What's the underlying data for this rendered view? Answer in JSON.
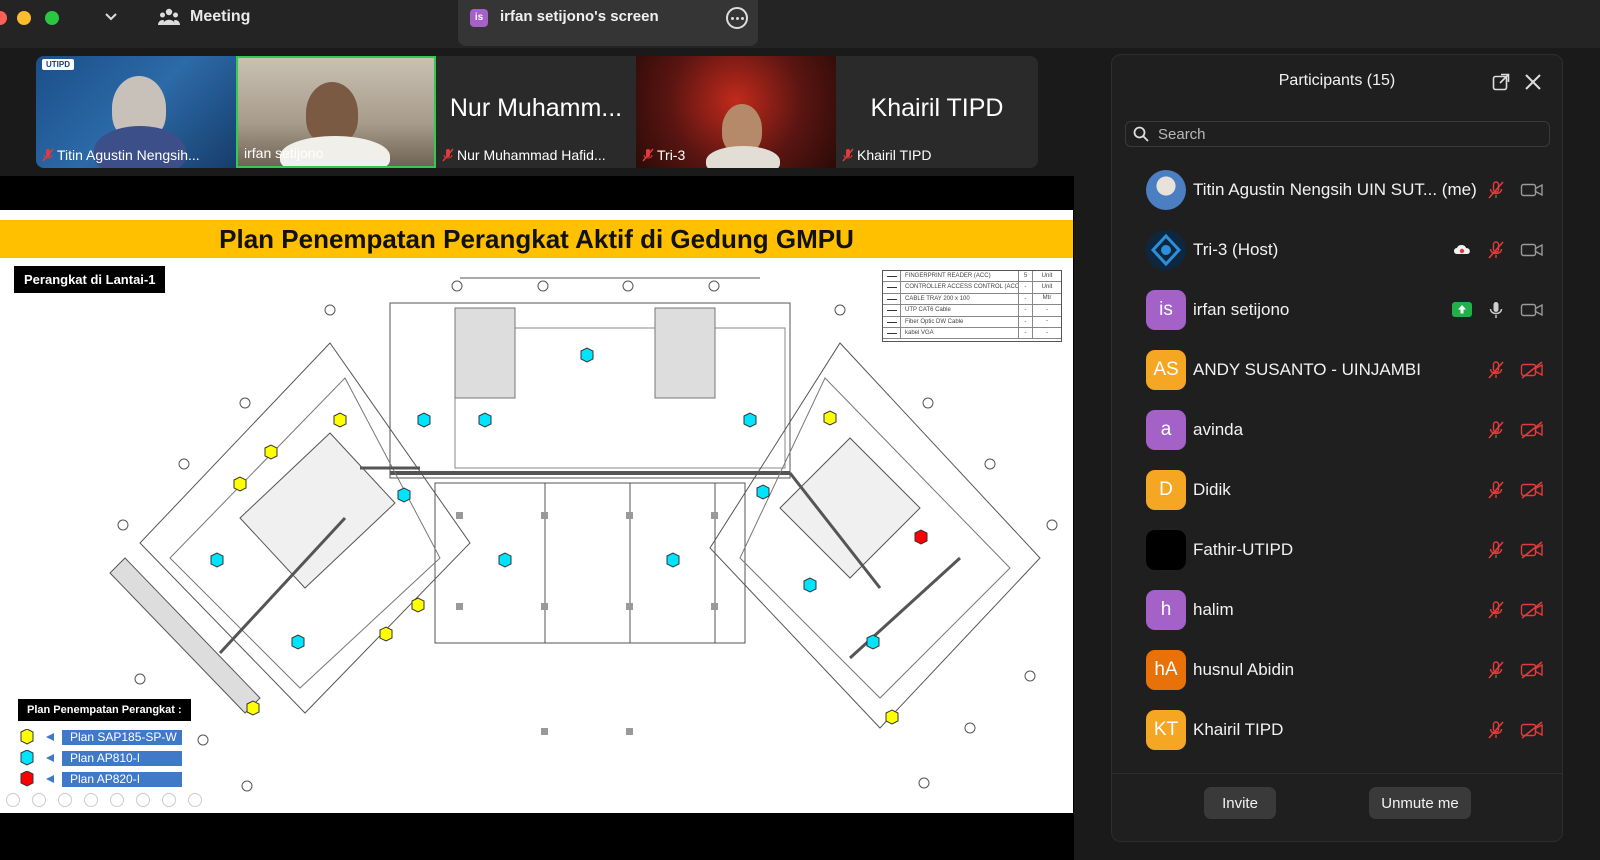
{
  "titlebar": {
    "meeting_label": "Meeting",
    "share_badge": "is",
    "share_label": "irfan setijono's screen"
  },
  "thumbnails": [
    {
      "name": "Titin Agustin Nengsih...",
      "muted": true,
      "video": true,
      "logo": "UTIPD"
    },
    {
      "name": "irfan setijono",
      "muted": false,
      "video": true,
      "active_speaker": true
    },
    {
      "name": "Nur Muhammad Hafid...",
      "big_name": "Nur Muhamm...",
      "muted": true,
      "video": false
    },
    {
      "name": "Tri-3",
      "muted": true,
      "video": true
    },
    {
      "name": "Khairil TIPD",
      "big_name": "Khairil TIPD",
      "muted": true,
      "video": false
    }
  ],
  "slide": {
    "title": "Plan Penempatan Perangkat Aktif di Gedung GMPU",
    "floor_label": "Perangkat di Lantai-1",
    "legend_title": "Plan Penempatan Perangkat :",
    "legend": [
      {
        "label": "Plan SAP185-SP-W",
        "shape": "hexagon",
        "color": "#ffff00"
      },
      {
        "label": "Plan AP810-I",
        "shape": "hexagon",
        "color": "#00e5ff"
      },
      {
        "label": "Plan AP820-I",
        "shape": "hexagon",
        "color": "#ff0000"
      }
    ],
    "cable_table": [
      {
        "desc": "FINGERPRINT READER (ACC)",
        "qty": "5",
        "unit": "Unit"
      },
      {
        "desc": "CONTROLLER ACCESS CONTROL (ACC)",
        "qty": "-",
        "unit": "Unit"
      },
      {
        "desc": "CABLE TRAY 200 x 100",
        "qty": "-",
        "unit": "Mtr"
      },
      {
        "desc": "UTP CAT6 Cable",
        "qty": "-",
        "unit": "-"
      },
      {
        "desc": "Fiber Optic DW Cable",
        "qty": "-",
        "unit": "-"
      },
      {
        "desc": "kabel VGA",
        "qty": "-",
        "unit": "-"
      }
    ]
  },
  "panel": {
    "title": "Participants (15)",
    "search_placeholder": "Search",
    "invite_label": "Invite",
    "unmute_label": "Unmute me",
    "participants": [
      {
        "name": "Titin Agustin Nengsih UIN SUT...  (me)",
        "initials": "",
        "color": "#4b7fc1",
        "mic": "muted",
        "cam": "on",
        "photo": true
      },
      {
        "name": "Tri-3 (Host)",
        "initials": "",
        "color": "#0e2740",
        "mic": "muted",
        "cam": "on",
        "photo": true,
        "extra": "cloud"
      },
      {
        "name": "irfan setijono",
        "initials": "is",
        "color": "#a462c9",
        "mic": "on",
        "cam": "on",
        "extra": "share"
      },
      {
        "name": "ANDY SUSANTO - UINJAMBI",
        "initials": "AS",
        "color": "#f5a623",
        "mic": "muted",
        "cam": "off"
      },
      {
        "name": "avinda",
        "initials": "a",
        "color": "#a462c9",
        "mic": "muted",
        "cam": "off"
      },
      {
        "name": "Didik",
        "initials": "D",
        "color": "#f5a623",
        "mic": "muted",
        "cam": "off"
      },
      {
        "name": "Fathir-UTIPD",
        "initials": "",
        "color": "#000000",
        "mic": "muted",
        "cam": "off"
      },
      {
        "name": "halim",
        "initials": "h",
        "color": "#a462c9",
        "mic": "muted",
        "cam": "off"
      },
      {
        "name": "husnul Abidin",
        "initials": "hA",
        "color": "#e8710a",
        "mic": "muted",
        "cam": "off"
      },
      {
        "name": "Khairil TIPD",
        "initials": "KT",
        "color": "#f5a623",
        "mic": "muted",
        "cam": "off"
      }
    ]
  }
}
